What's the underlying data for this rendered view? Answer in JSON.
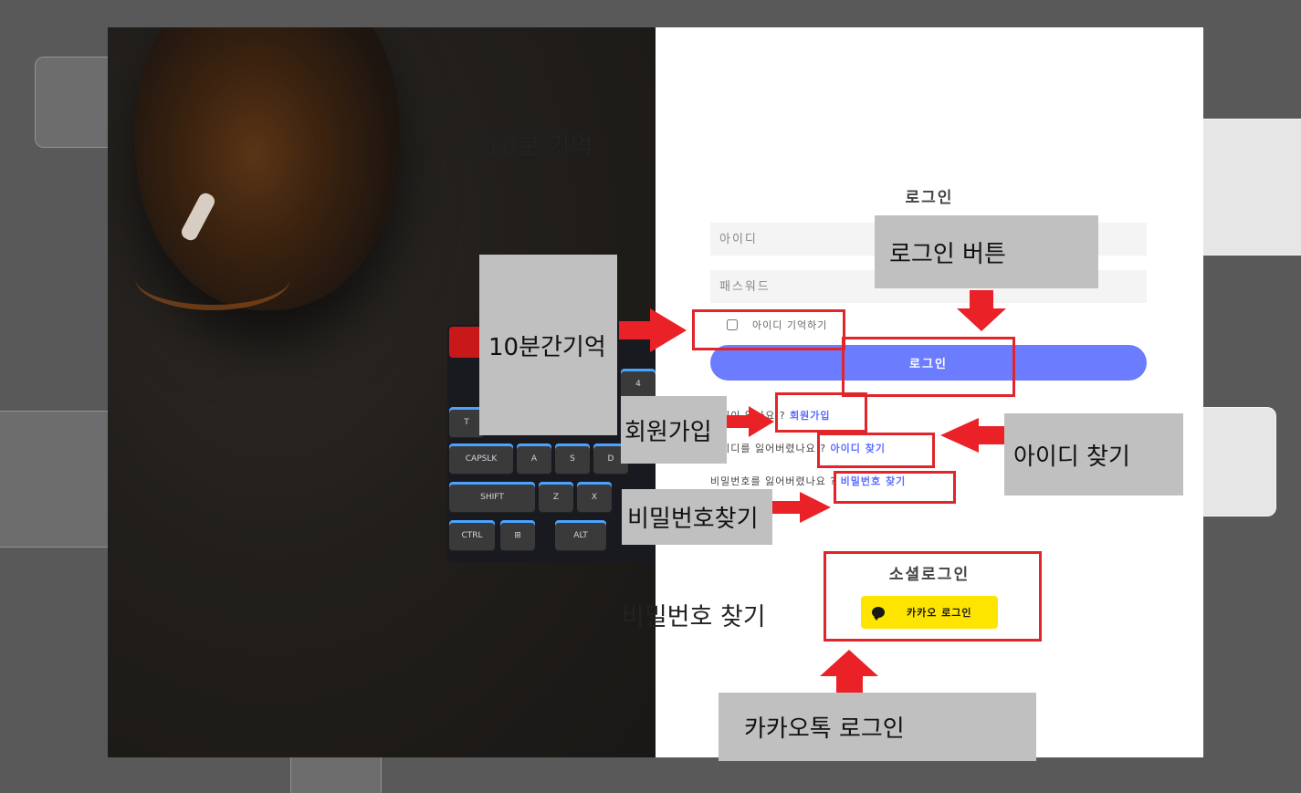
{
  "background": "#595959",
  "accent": "#6b7cff",
  "annotation_color": "#ea2227",
  "photo": {
    "keys": [
      "4",
      "T",
      "CAPSLK",
      "A",
      "S",
      "D",
      "SHIFT",
      "Z",
      "X",
      "CTRL",
      "ALT"
    ]
  },
  "login": {
    "title": "로그인",
    "id_placeholder": "아이디",
    "pw_placeholder": "패스워드",
    "remember_label": "아이디 기억하기",
    "login_button": "로그인",
    "signup_prompt": "회원이 없나요 ?",
    "signup_link": "회원가입",
    "find_id_prompt": "아이디를 잃어버렸나요 ?",
    "find_id_link": "아이디 찾기",
    "find_pw_prompt": "비밀번호를 잃어버렸나요 ?",
    "find_pw_link": "비밀번호 찾기",
    "social_title": "소셜로그인",
    "kakao_button": "카카오 로그인"
  },
  "annotations": {
    "ten_min_memory": "10분 기억",
    "ten_min_memory_box": "10분간기억",
    "login_button_note": "로그인 버튼",
    "signup_note": "회원가입",
    "find_id_note": "아이디 찾기",
    "find_pw_note_box": "비밀번호찾기",
    "find_pw_note": "비밀번호 찾기",
    "kakao_note": "카카오톡 로그인"
  }
}
